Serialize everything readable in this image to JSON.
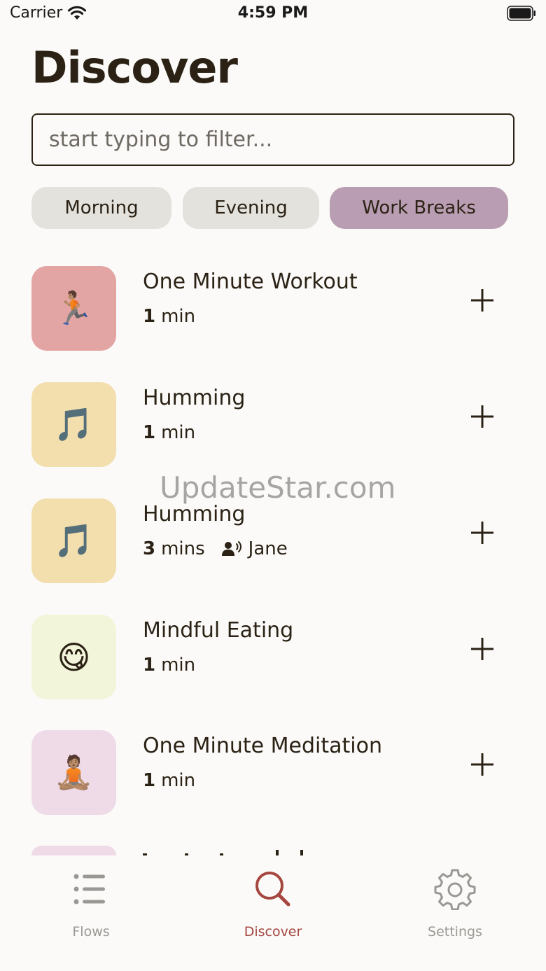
{
  "status_bar": {
    "carrier": "Carrier",
    "time": "4:59 PM"
  },
  "page": {
    "title": "Discover"
  },
  "search": {
    "placeholder": "start typing to filter..."
  },
  "filters": [
    {
      "label": "Morning",
      "active": false
    },
    {
      "label": "Evening",
      "active": false
    },
    {
      "label": "Work Breaks",
      "active": true
    }
  ],
  "flows": [
    {
      "title": "One Minute Workout",
      "duration": "1",
      "unit": "min",
      "emoji": "🏃🏽",
      "color": "#e3a5a3"
    },
    {
      "title": "Humming",
      "duration": "1",
      "unit": "min",
      "emoji": "🎵",
      "color": "#f2dfad"
    },
    {
      "title": "Humming",
      "duration": "3",
      "unit": "mins",
      "narrator": "Jane",
      "emoji": "🎵",
      "color": "#f2dfad"
    },
    {
      "title": "Mindful Eating",
      "duration": "1",
      "unit": "min",
      "emoji": "😋",
      "color": "#f2f5da"
    },
    {
      "title": "One Minute Meditation",
      "duration": "1",
      "unit": "min",
      "emoji": "🧘🏽",
      "color": "#efdbe8"
    }
  ],
  "watermark": "UpdateStar.com",
  "tabs": [
    {
      "label": "Flows",
      "icon": "list-icon",
      "active": false
    },
    {
      "label": "Discover",
      "icon": "search-icon",
      "active": true
    },
    {
      "label": "Settings",
      "icon": "gear-icon",
      "active": false
    }
  ],
  "colors": {
    "accent": "#a5463f",
    "text": "#2b2215",
    "chip": "#e4e2dd",
    "chip_active": "#b99db2"
  }
}
